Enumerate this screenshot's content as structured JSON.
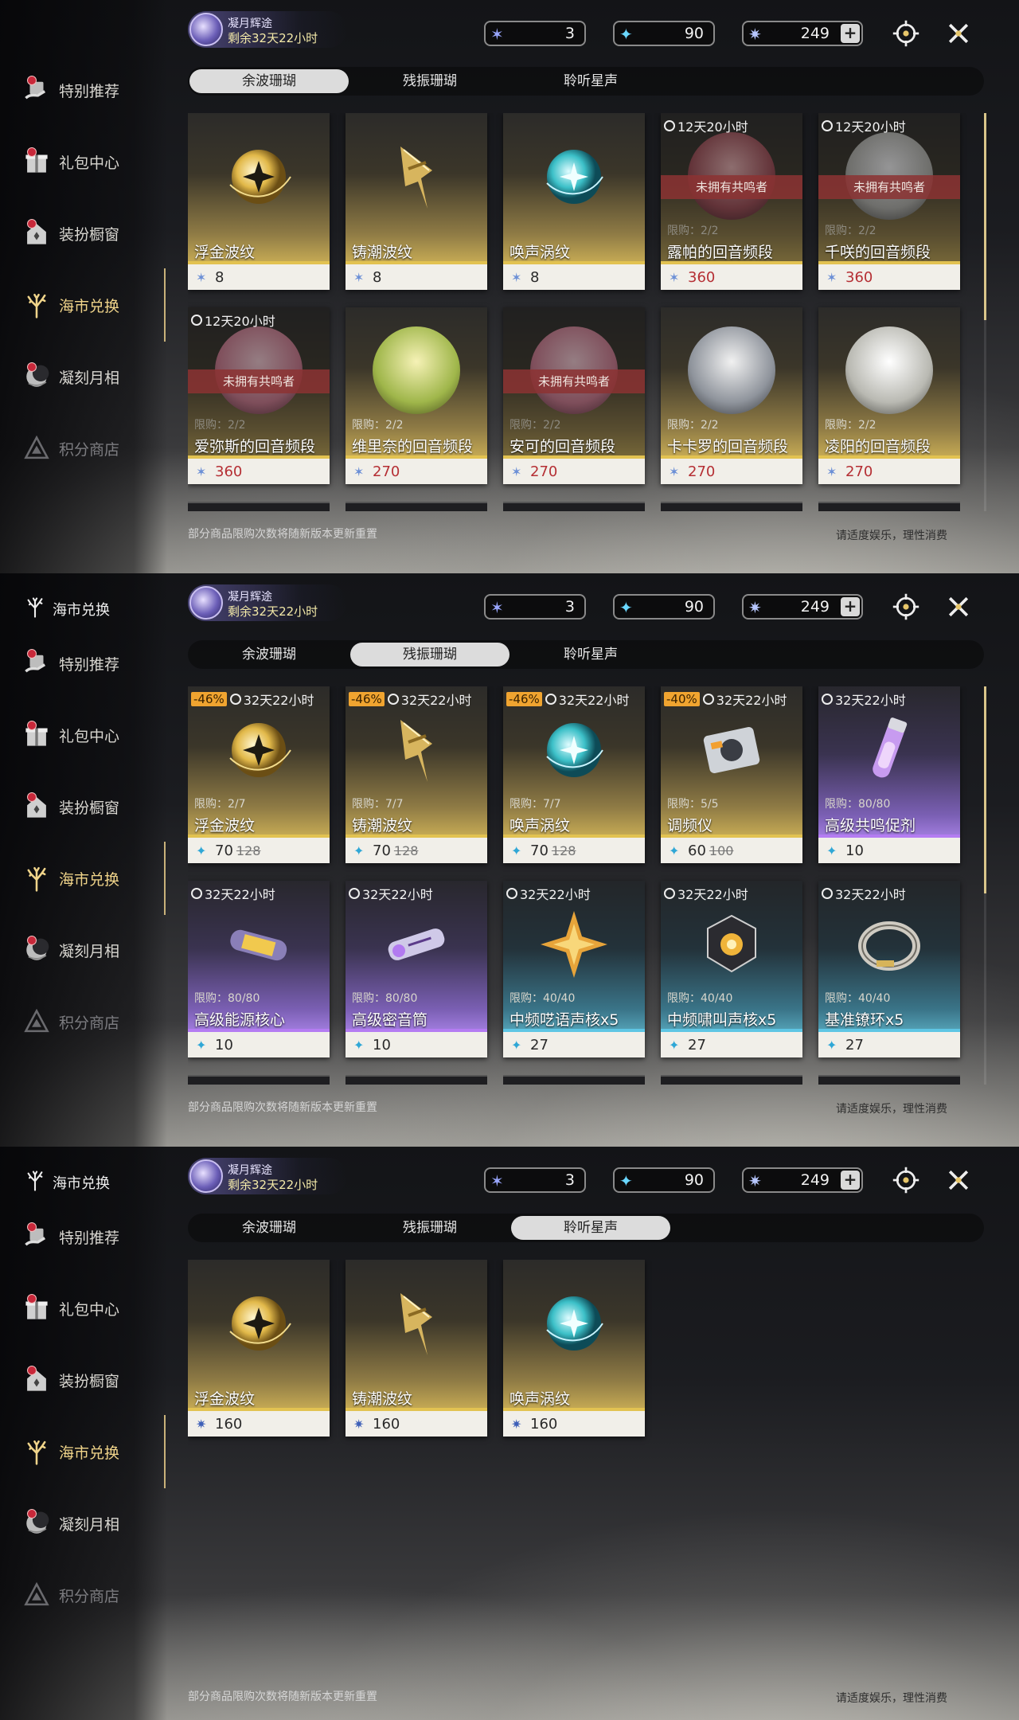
{
  "nav": {
    "header_label": "海市兑换",
    "items": [
      {
        "label": "特别推荐"
      },
      {
        "label": "礼包中心"
      },
      {
        "label": "装扮橱窗"
      },
      {
        "label": "海市兑换"
      },
      {
        "label": "凝刻月相"
      },
      {
        "label": "积分商店"
      }
    ]
  },
  "event": {
    "title": "凝月辉途",
    "remaining": "剩余32天22小时"
  },
  "currency": {
    "a": "3",
    "b": "90",
    "c": "249",
    "plus": "+"
  },
  "tabs": [
    "余波珊瑚",
    "残振珊瑚",
    "聆听星声"
  ],
  "footer": {
    "left": "部分商品限购次数将随新版本更新重置",
    "right": "请适度娱乐，理性消费"
  },
  "panel1": {
    "selected_tab": 0,
    "cards": [
      {
        "name": "浮金波纹",
        "price": "8",
        "tier": "gold",
        "art": "orb-gold"
      },
      {
        "name": "铸潮波纹",
        "price": "8",
        "tier": "gold",
        "art": "blade"
      },
      {
        "name": "唤声涡纹",
        "price": "8",
        "tier": "gold",
        "art": "orb-teal"
      },
      {
        "name": "露帕的回音频段",
        "price": "360",
        "tier": "gold",
        "timer": "12天20小时",
        "limit": "限购：2/2",
        "overlay": "未拥有共鸣者",
        "art": "portrait-red"
      },
      {
        "name": "千咲的回音频段",
        "price": "360",
        "tier": "gold",
        "timer": "12天20小时",
        "limit": "限购：2/2",
        "overlay": "未拥有共鸣者",
        "art": "portrait-white"
      },
      {
        "name": "爱弥斯的回音频段",
        "price": "360",
        "tier": "gold",
        "timer": "12天20小时",
        "limit": "限购：2/2",
        "overlay": "未拥有共鸣者",
        "art": "portrait-pink"
      },
      {
        "name": "维里奈的回音频段",
        "price": "270",
        "tier": "gold",
        "limit": "限购：2/2",
        "art": "portrait-green"
      },
      {
        "name": "安可的回音频段",
        "price": "270",
        "tier": "gold",
        "limit": "限购：2/2",
        "overlay": "未拥有共鸣者",
        "art": "portrait-pink"
      },
      {
        "name": "卡卡罗的回音频段",
        "price": "270",
        "tier": "gold",
        "limit": "限购：2/2",
        "art": "portrait-silver"
      },
      {
        "name": "凌阳的回音频段",
        "price": "270",
        "tier": "gold",
        "limit": "限购：2/2",
        "art": "portrait-white"
      }
    ]
  },
  "panel2": {
    "selected_tab": 1,
    "cards": [
      {
        "name": "浮金波纹",
        "price": "70",
        "old_price": "128",
        "tier": "gold",
        "discount": "-46%",
        "timer": "32天22小时",
        "limit": "限购：2/7",
        "art": "orb-gold"
      },
      {
        "name": "铸潮波纹",
        "price": "70",
        "old_price": "128",
        "tier": "gold",
        "discount": "-46%",
        "timer": "32天22小时",
        "limit": "限购：7/7",
        "art": "blade"
      },
      {
        "name": "唤声涡纹",
        "price": "70",
        "old_price": "128",
        "tier": "gold",
        "discount": "-46%",
        "timer": "32天22小时",
        "limit": "限购：7/7",
        "art": "orb-teal"
      },
      {
        "name": "调频仪",
        "price": "60",
        "old_price": "100",
        "tier": "gold",
        "discount": "-40%",
        "timer": "32天22小时",
        "limit": "限购：5/5",
        "art": "device"
      },
      {
        "name": "高级共鸣促剂",
        "price": "10",
        "tier": "purple",
        "timer": "32天22小时",
        "limit": "限购：80/80",
        "art": "vial"
      },
      {
        "name": "高级能源核心",
        "price": "10",
        "tier": "purple",
        "timer": "32天22小时",
        "limit": "限购：80/80",
        "art": "capsule-gold"
      },
      {
        "name": "高级密音筒",
        "price": "10",
        "tier": "purple",
        "timer": "32天22小时",
        "limit": "限购：80/80",
        "art": "capsule-purple"
      },
      {
        "name": "中频呓语声核x5",
        "price": "27",
        "tier": "blue",
        "timer": "32天22小时",
        "limit": "限购：40/40",
        "art": "star"
      },
      {
        "name": "中频啸叫声核x5",
        "price": "27",
        "tier": "blue",
        "timer": "32天22小时",
        "limit": "限购：40/40",
        "art": "core"
      },
      {
        "name": "基准镣环x5",
        "price": "27",
        "tier": "blue",
        "timer": "32天22小时",
        "limit": "限购：40/40",
        "art": "ring"
      }
    ]
  },
  "panel3": {
    "selected_tab": 2,
    "cards": [
      {
        "name": "浮金波纹",
        "price": "160",
        "tier": "gold",
        "art": "orb-gold"
      },
      {
        "name": "铸潮波纹",
        "price": "160",
        "tier": "gold",
        "art": "blade"
      },
      {
        "name": "唤声涡纹",
        "price": "160",
        "tier": "gold",
        "art": "orb-teal"
      }
    ]
  },
  "colors": {
    "accent_gold": "#e2c251",
    "accent_purple": "#b47cf2",
    "accent_blue": "#5fc6e4",
    "discount": "#f0a430",
    "unowned": "#8c3232"
  },
  "icons": {
    "nav": [
      "gift-hand-icon",
      "gift-box-icon",
      "wardrobe-icon",
      "coral-icon",
      "moon-icon",
      "triangle-icon"
    ],
    "system": [
      "crosshair-icon",
      "close-icon"
    ]
  }
}
